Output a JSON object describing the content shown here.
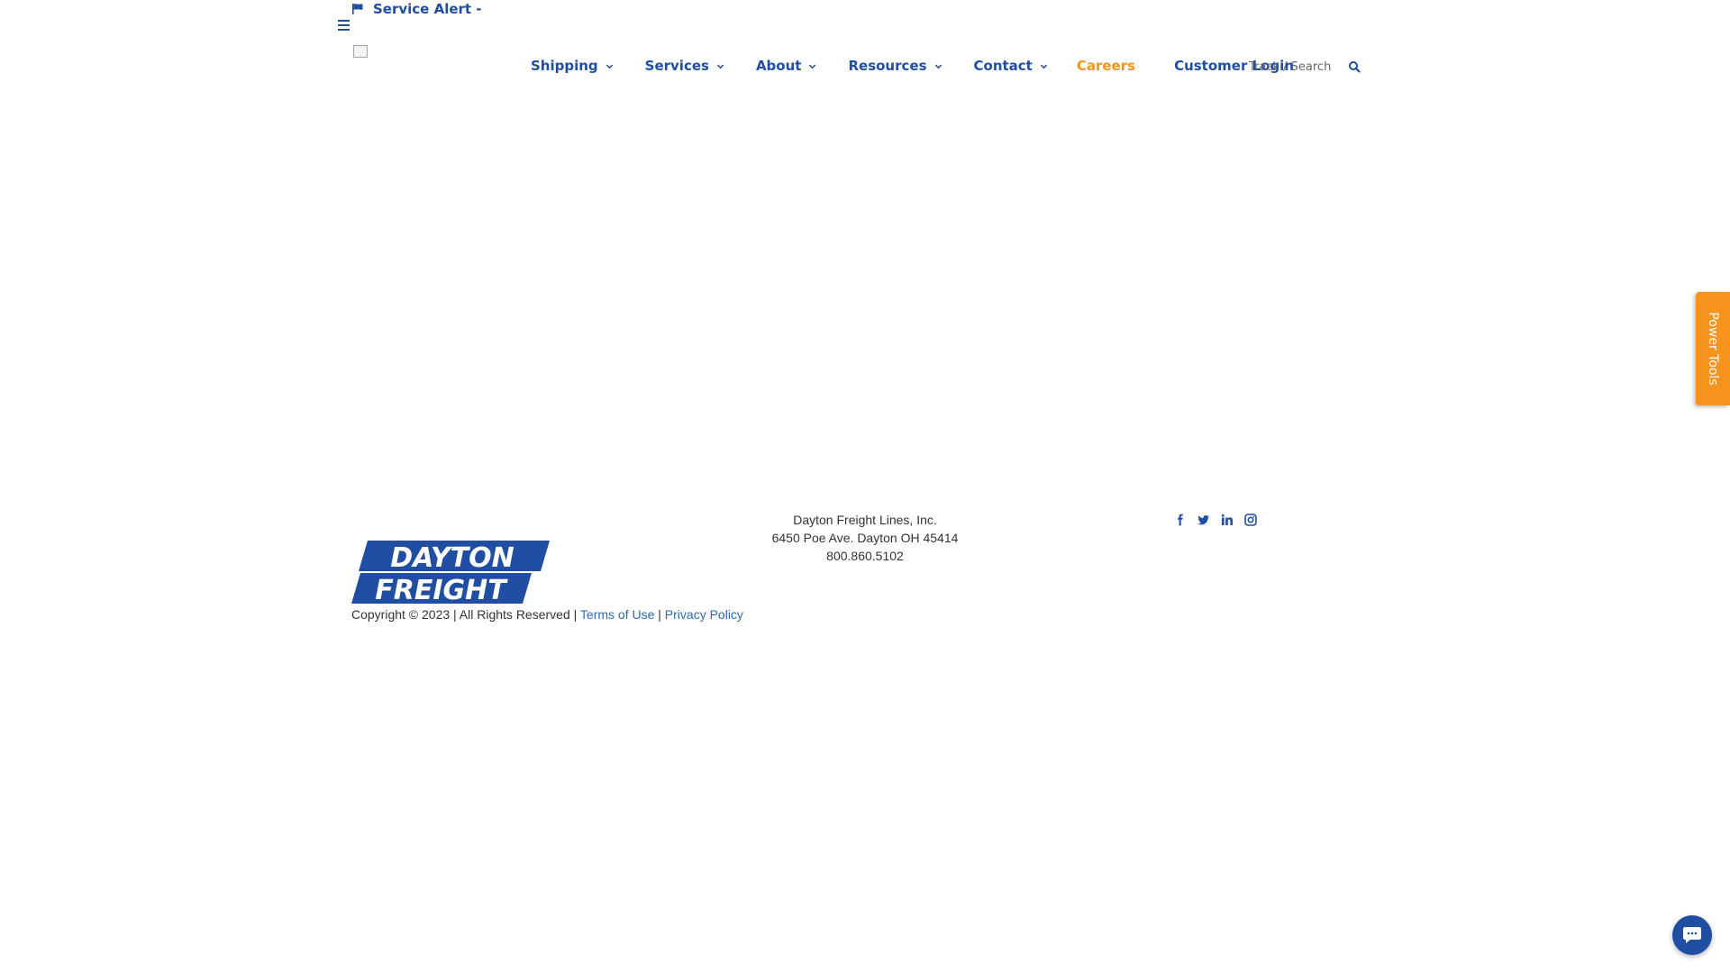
{
  "alert": {
    "text": "Service Alert -",
    "icon": "flag-icon"
  },
  "nav": {
    "items": [
      {
        "label": "Shipping",
        "dropdown": true
      },
      {
        "label": "Services",
        "dropdown": true
      },
      {
        "label": "About",
        "dropdown": true
      },
      {
        "label": "Resources",
        "dropdown": true
      },
      {
        "label": "Contact",
        "dropdown": true
      },
      {
        "label": "Careers",
        "dropdown": false
      },
      {
        "label": "Customer Login",
        "dropdown": false
      }
    ],
    "search_placeholder": "Track / Search"
  },
  "power_tools": {
    "label": "Power Tools"
  },
  "footer": {
    "company": "Dayton Freight Lines, Inc.",
    "address": "6450 Poe Ave. Dayton OH 45414",
    "phone": "800.860.5102",
    "logo": {
      "line1": "DAYTON",
      "line2": "FREIGHT"
    },
    "copyright": "Copyright © 2023 | All Rights Reserved |",
    "terms": "Terms of Use",
    "separator": "|",
    "privacy": "Privacy Policy"
  },
  "colors": {
    "brand_blue": "#1f4ea3",
    "accent_orange": "#f7941d",
    "link_blue": "#2a6bb8"
  }
}
